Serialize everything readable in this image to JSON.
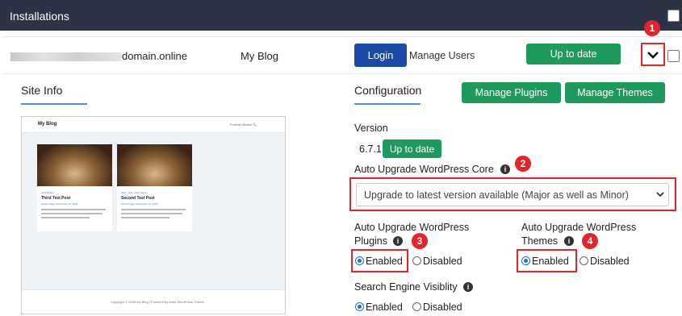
{
  "header": {
    "title": "Installations"
  },
  "row": {
    "domain": "domain.online",
    "site_name": "My Blog",
    "login": "Login",
    "manage_users": "Manage Users",
    "status": "Up to date"
  },
  "site_info": {
    "heading": "Site Info",
    "preview": {
      "blog_title": "My Blog",
      "nav": "Portfolio   Books   🔍",
      "posts": [
        {
          "meta": "Java Basics",
          "title": "Third Test Post",
          "date": "Hosted Tags / December 27, 2026"
        },
        {
          "meta": "Sites, Java, Java Topics",
          "title": "Second Test Post",
          "date": "Hosted Tags / December 27, 2026"
        }
      ],
      "footer": "Copyright © 2026 My Blog | Powered by Astra WordPress Theme"
    }
  },
  "config": {
    "heading": "Configuration",
    "manage_plugins": "Manage Plugins",
    "manage_themes": "Manage Themes",
    "version_label": "Version",
    "version_value": "6.7.1",
    "version_status": "Up to date",
    "auto_core_label": "Auto Upgrade WordPress Core",
    "auto_core_value": "Upgrade to latest version available (Major as well as Minor)",
    "plugins_label_1": "Auto Upgrade WordPress",
    "plugins_label_2": "Plugins",
    "themes_label_1": "Auto Upgrade WordPress",
    "themes_label_2": "Themes",
    "enabled": "Enabled",
    "disabled": "Disabled",
    "search_label": "Search Engine Visiblity"
  },
  "annotations": [
    "1",
    "2",
    "3",
    "4"
  ],
  "colors": {
    "header_bg": "#2b3345",
    "green": "#1e9a5c",
    "blue": "#1c4aa8",
    "highlight": "#e3242b"
  }
}
